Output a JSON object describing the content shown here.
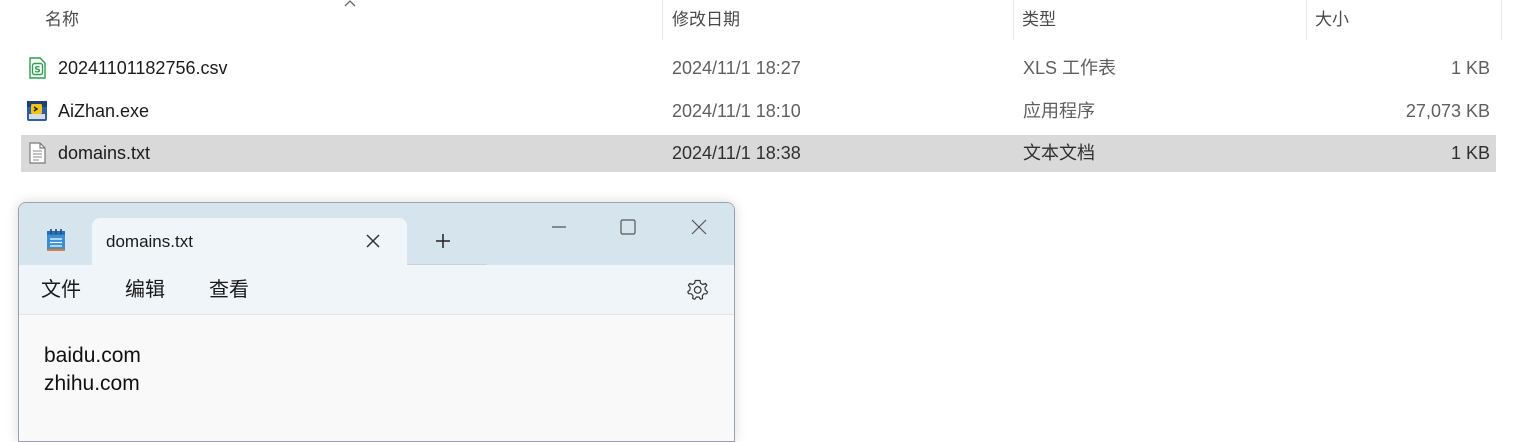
{
  "explorer": {
    "columns": {
      "name": "名称",
      "modified": "修改日期",
      "type": "类型",
      "size": "大小"
    },
    "files": [
      {
        "name": "20241101182756.csv",
        "modified": "2024/11/1 18:27",
        "type": "XLS 工作表",
        "size": "1 KB",
        "icon": "csv-file-icon",
        "selected": false
      },
      {
        "name": "AiZhan.exe",
        "modified": "2024/11/1 18:10",
        "type": "应用程序",
        "size": "27,073 KB",
        "icon": "exe-file-icon",
        "selected": false
      },
      {
        "name": "domains.txt",
        "modified": "2024/11/1 18:38",
        "type": "文本文档",
        "size": "1 KB",
        "icon": "txt-file-icon",
        "selected": true
      }
    ]
  },
  "notepad": {
    "tab_title": "domains.txt",
    "menu": {
      "file": "文件",
      "edit": "编辑",
      "view": "查看"
    },
    "content_lines": [
      "baidu.com",
      "zhihu.com"
    ]
  },
  "colors": {
    "selection": "#d9d9d9",
    "titlebar": "#d6e4ee",
    "menubar": "#f0f5f9",
    "csv_icon_green": "#2e9e4f"
  }
}
